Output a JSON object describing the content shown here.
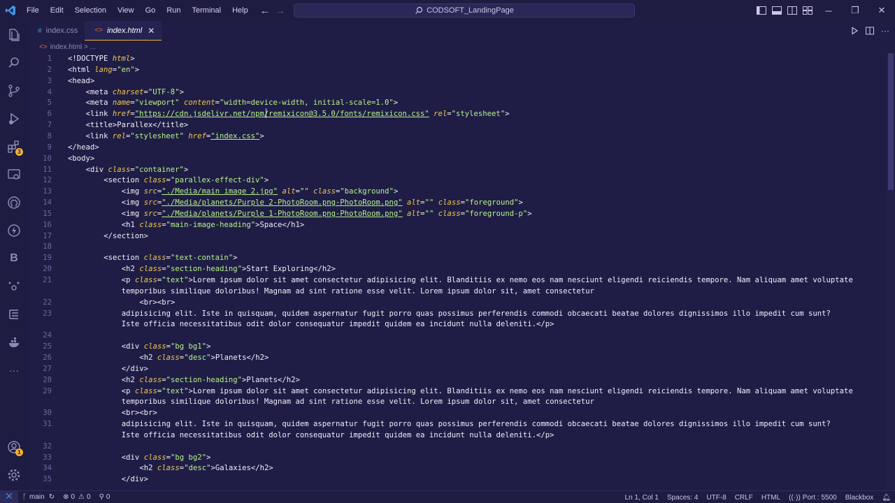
{
  "menu": [
    "File",
    "Edit",
    "Selection",
    "View",
    "Go",
    "Run",
    "Terminal",
    "Help"
  ],
  "command_center": {
    "label": "CODSOFT_LandingPage"
  },
  "tabs": [
    {
      "label": "index.css",
      "icon": "css-file-icon",
      "active": false
    },
    {
      "label": "index.html",
      "icon": "html-file-icon",
      "active": true
    }
  ],
  "breadcrumb": {
    "file": "index.html",
    "sep": ">",
    "rest": "..."
  },
  "activity_badges": {
    "extensions": "3",
    "accounts": "1"
  },
  "editor": {
    "lines": [
      {
        "n": "1",
        "indent": 0,
        "parts": [
          [
            "t",
            "<!DOCTYPE "
          ],
          [
            "a",
            "html"
          ],
          [
            "t",
            ">"
          ]
        ]
      },
      {
        "n": "2",
        "indent": 0,
        "parts": [
          [
            "t",
            "<html "
          ],
          [
            "a",
            "lang"
          ],
          [
            "t",
            "="
          ],
          [
            "s",
            "\"en\""
          ],
          [
            "t",
            ">"
          ]
        ]
      },
      {
        "n": "3",
        "indent": 0,
        "parts": [
          [
            "t",
            "<head>"
          ]
        ]
      },
      {
        "n": "4",
        "indent": 1,
        "parts": [
          [
            "t",
            "<meta "
          ],
          [
            "a",
            "charset"
          ],
          [
            "t",
            "="
          ],
          [
            "s",
            "\"UTF-8\""
          ],
          [
            "t",
            ">"
          ]
        ]
      },
      {
        "n": "5",
        "indent": 1,
        "parts": [
          [
            "t",
            "<meta "
          ],
          [
            "a",
            "name"
          ],
          [
            "t",
            "="
          ],
          [
            "s",
            "\"viewport\""
          ],
          [
            "t",
            " "
          ],
          [
            "a",
            "content"
          ],
          [
            "t",
            "="
          ],
          [
            "s",
            "\"width=device-width, initial-scale=1.0\""
          ],
          [
            "t",
            ">"
          ]
        ]
      },
      {
        "n": "6",
        "indent": 1,
        "parts": [
          [
            "t",
            "<link "
          ],
          [
            "a",
            "href"
          ],
          [
            "t",
            "="
          ],
          [
            "su",
            "\"https://cdn.jsdelivr.net/npm/remixicon@3.5.0/fonts/remixicon.css\""
          ],
          [
            "t",
            " "
          ],
          [
            "a",
            "rel"
          ],
          [
            "t",
            "="
          ],
          [
            "s",
            "\"stylesheet\""
          ],
          [
            "t",
            ">"
          ]
        ]
      },
      {
        "n": "7",
        "indent": 1,
        "parts": [
          [
            "t",
            "<title>Parallex</title>"
          ]
        ]
      },
      {
        "n": "8",
        "indent": 1,
        "parts": [
          [
            "t",
            "<link "
          ],
          [
            "a",
            "rel"
          ],
          [
            "t",
            "="
          ],
          [
            "s",
            "\"stylesheet\""
          ],
          [
            "t",
            " "
          ],
          [
            "a",
            "href"
          ],
          [
            "t",
            "="
          ],
          [
            "su",
            "\"index.css\""
          ],
          [
            "t",
            ">"
          ]
        ]
      },
      {
        "n": "9",
        "indent": 0,
        "parts": [
          [
            "t",
            "</head>"
          ]
        ]
      },
      {
        "n": "10",
        "indent": 0,
        "parts": [
          [
            "t",
            "<body>"
          ]
        ]
      },
      {
        "n": "11",
        "indent": 1,
        "parts": [
          [
            "t",
            "<div "
          ],
          [
            "a",
            "class"
          ],
          [
            "t",
            "="
          ],
          [
            "s",
            "\"container\""
          ],
          [
            "t",
            ">"
          ]
        ]
      },
      {
        "n": "12",
        "indent": 2,
        "parts": [
          [
            "t",
            "<section "
          ],
          [
            "a",
            "class"
          ],
          [
            "t",
            "="
          ],
          [
            "s",
            "\"parallex-effect-div\""
          ],
          [
            "t",
            ">"
          ]
        ]
      },
      {
        "n": "13",
        "indent": 3,
        "parts": [
          [
            "t",
            "<img "
          ],
          [
            "a",
            "src"
          ],
          [
            "t",
            "="
          ],
          [
            "su",
            "\"./Media/main image 2.jpg\""
          ],
          [
            "t",
            " "
          ],
          [
            "a",
            "alt"
          ],
          [
            "t",
            "="
          ],
          [
            "s",
            "\"\""
          ],
          [
            "t",
            " "
          ],
          [
            "a",
            "class"
          ],
          [
            "t",
            "="
          ],
          [
            "s",
            "\"background\""
          ],
          [
            "t",
            ">"
          ]
        ]
      },
      {
        "n": "14",
        "indent": 3,
        "parts": [
          [
            "t",
            "<img "
          ],
          [
            "a",
            "src"
          ],
          [
            "t",
            "="
          ],
          [
            "su",
            "\"./Media/planets/Purple 2-PhotoRoom.png-PhotoRoom.png\""
          ],
          [
            "t",
            " "
          ],
          [
            "a",
            "alt"
          ],
          [
            "t",
            "="
          ],
          [
            "s",
            "\"\""
          ],
          [
            "t",
            " "
          ],
          [
            "a",
            "class"
          ],
          [
            "t",
            "="
          ],
          [
            "s",
            "\"foreground\""
          ],
          [
            "t",
            ">"
          ]
        ]
      },
      {
        "n": "15",
        "indent": 3,
        "parts": [
          [
            "t",
            "<img "
          ],
          [
            "a",
            "src"
          ],
          [
            "t",
            "="
          ],
          [
            "su",
            "\"./Media/planets/Purple 1-PhotoRoom.png-PhotoRoom.png\""
          ],
          [
            "t",
            " "
          ],
          [
            "a",
            "alt"
          ],
          [
            "t",
            "="
          ],
          [
            "s",
            "\"\""
          ],
          [
            "t",
            " "
          ],
          [
            "a",
            "class"
          ],
          [
            "t",
            "="
          ],
          [
            "s",
            "\"foreground-p\""
          ],
          [
            "t",
            ">"
          ]
        ]
      },
      {
        "n": "16",
        "indent": 3,
        "parts": [
          [
            "t",
            "<h1 "
          ],
          [
            "a",
            "class"
          ],
          [
            "t",
            "="
          ],
          [
            "s",
            "\"main-image-heading\""
          ],
          [
            "t",
            ">Space</h1>"
          ]
        ]
      },
      {
        "n": "17",
        "indent": 2,
        "parts": [
          [
            "t",
            "</section>"
          ]
        ]
      },
      {
        "n": "18",
        "indent": 0,
        "parts": []
      },
      {
        "n": "19",
        "indent": 2,
        "parts": [
          [
            "t",
            "<section "
          ],
          [
            "a",
            "class"
          ],
          [
            "t",
            "="
          ],
          [
            "s",
            "\"text-contain\""
          ],
          [
            "t",
            ">"
          ]
        ]
      },
      {
        "n": "20",
        "indent": 3,
        "parts": [
          [
            "t",
            "<h2 "
          ],
          [
            "a",
            "class"
          ],
          [
            "t",
            "="
          ],
          [
            "s",
            "\"section-heading\""
          ],
          [
            "t",
            ">Start Exploring</h2>"
          ]
        ]
      },
      {
        "n": "21",
        "indent": 3,
        "parts": [
          [
            "t",
            "<p "
          ],
          [
            "a",
            "class"
          ],
          [
            "t",
            "="
          ],
          [
            "s",
            "\"text\""
          ],
          [
            "t",
            ">Lorem ipsum dolor sit amet consectetur adipisicing elit. Blanditiis ex nemo eos nam nesciunt eligendi reiciendis tempore. Nam aliquam amet voluptate"
          ]
        ]
      },
      {
        "n": "",
        "indent": 3,
        "parts": [
          [
            "t",
            "temporibus similique doloribus! Magnam ad sint ratione esse velit. Lorem ipsum dolor sit, amet consectetur"
          ]
        ]
      },
      {
        "n": "22",
        "indent": 4,
        "parts": [
          [
            "t",
            "<br><br>"
          ]
        ]
      },
      {
        "n": "23",
        "indent": 3,
        "parts": [
          [
            "t",
            "adipisicing elit. Iste in quisquam, quidem aspernatur fugit porro quas possimus perferendis commodi obcaecati beatae dolores dignissimos illo impedit cum sunt?"
          ]
        ]
      },
      {
        "n": "",
        "indent": 3,
        "parts": [
          [
            "t",
            "Iste officia necessitatibus odit dolor consequatur impedit quidem ea incidunt nulla deleniti.</p>"
          ]
        ]
      },
      {
        "n": "24",
        "indent": 0,
        "parts": []
      },
      {
        "n": "25",
        "indent": 3,
        "parts": [
          [
            "t",
            "<div "
          ],
          [
            "a",
            "class"
          ],
          [
            "t",
            "="
          ],
          [
            "s",
            "\"bg bg1\""
          ],
          [
            "t",
            ">"
          ]
        ]
      },
      {
        "n": "26",
        "indent": 4,
        "parts": [
          [
            "t",
            "<h2 "
          ],
          [
            "a",
            "class"
          ],
          [
            "t",
            "="
          ],
          [
            "s",
            "\"desc\""
          ],
          [
            "t",
            ">Planets</h2>"
          ]
        ]
      },
      {
        "n": "27",
        "indent": 3,
        "parts": [
          [
            "t",
            "</div>"
          ]
        ]
      },
      {
        "n": "28",
        "indent": 3,
        "parts": [
          [
            "t",
            "<h2 "
          ],
          [
            "a",
            "class"
          ],
          [
            "t",
            "="
          ],
          [
            "s",
            "\"section-heading\""
          ],
          [
            "t",
            ">Planets</h2>"
          ]
        ]
      },
      {
        "n": "29",
        "indent": 3,
        "parts": [
          [
            "t",
            "<p "
          ],
          [
            "a",
            "class"
          ],
          [
            "t",
            "="
          ],
          [
            "s",
            "\"text\""
          ],
          [
            "t",
            ">Lorem ipsum dolor sit amet consectetur adipisicing elit. Blanditiis ex nemo eos nam nesciunt eligendi reiciendis tempore. Nam aliquam amet voluptate"
          ]
        ]
      },
      {
        "n": "",
        "indent": 3,
        "parts": [
          [
            "t",
            "temporibus similique doloribus! Magnam ad sint ratione esse velit. Lorem ipsum dolor sit, amet consectetur"
          ]
        ]
      },
      {
        "n": "30",
        "indent": 3,
        "parts": [
          [
            "t",
            "<br><br>"
          ]
        ]
      },
      {
        "n": "31",
        "indent": 3,
        "parts": [
          [
            "t",
            "adipisicing elit. Iste in quisquam, quidem aspernatur fugit porro quas possimus perferendis commodi obcaecati beatae dolores dignissimos illo impedit cum sunt?"
          ]
        ]
      },
      {
        "n": "",
        "indent": 3,
        "parts": [
          [
            "t",
            "Iste officia necessitatibus odit dolor consequatur impedit quidem ea incidunt nulla deleniti.</p>"
          ]
        ]
      },
      {
        "n": "32",
        "indent": 0,
        "parts": []
      },
      {
        "n": "33",
        "indent": 3,
        "parts": [
          [
            "t",
            "<div "
          ],
          [
            "a",
            "class"
          ],
          [
            "t",
            "="
          ],
          [
            "s",
            "\"bg bg2\""
          ],
          [
            "t",
            ">"
          ]
        ]
      },
      {
        "n": "34",
        "indent": 4,
        "parts": [
          [
            "t",
            "<h2 "
          ],
          [
            "a",
            "class"
          ],
          [
            "t",
            "="
          ],
          [
            "s",
            "\"desc\""
          ],
          [
            "t",
            ">Galaxies</h2>"
          ]
        ]
      },
      {
        "n": "35",
        "indent": 3,
        "parts": [
          [
            "t",
            "</div>"
          ]
        ]
      }
    ]
  },
  "statusbar": {
    "branch": "main",
    "errors": "0",
    "warnings": "0",
    "ports": "0",
    "position": "Ln 1, Col 1",
    "spaces": "Spaces: 4",
    "encoding": "UTF-8",
    "eol": "CRLF",
    "language": "HTML",
    "port": "Port : 5500",
    "extension": "Blackbox"
  }
}
